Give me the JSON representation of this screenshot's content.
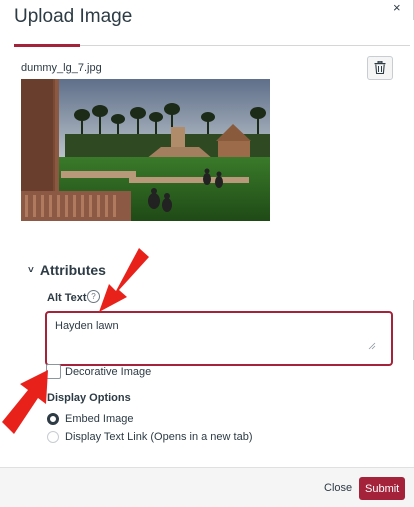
{
  "modal": {
    "title": "Upload Image",
    "close_icon": "×",
    "filename": "dummy_lg_7.jpg",
    "delete_icon": "trash-icon"
  },
  "attributes": {
    "heading": "Attributes",
    "chevron": "˅",
    "alt_text_label": "Alt Text",
    "alt_text_value": "Hayden lawn",
    "info_icon": "?",
    "decorative_label": "Decorative Image",
    "decorative_checked": false
  },
  "display_options": {
    "label": "Display Options",
    "options": [
      {
        "label": "Embed Image",
        "selected": true
      },
      {
        "label": "Display Text Link (Opens in a new tab)",
        "selected": false
      }
    ]
  },
  "footer": {
    "close_label": "Close",
    "submit_label": "Submit"
  },
  "colors": {
    "accent": "#a5223b",
    "annotation_arrow": "#e8221b"
  }
}
